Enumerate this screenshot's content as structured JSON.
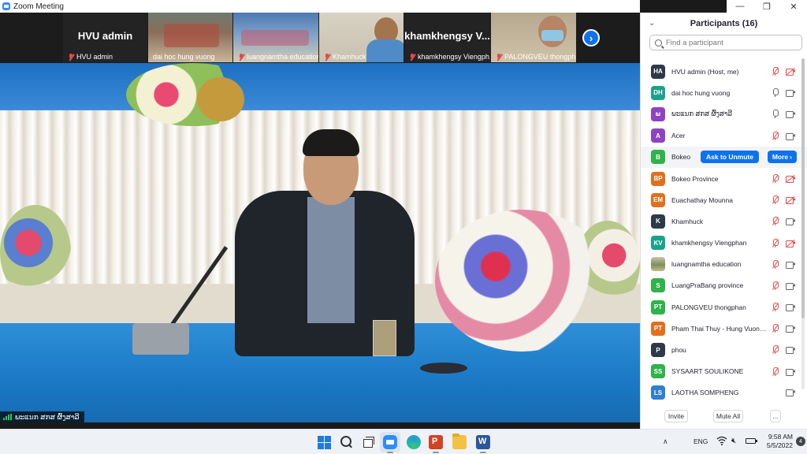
{
  "window": {
    "title": "Zoom Meeting",
    "controls": [
      "—",
      "❐",
      "✕"
    ]
  },
  "thumbnails": [
    {
      "name": "HVU admin",
      "big_label": "HVU admin",
      "muted": true
    },
    {
      "name": "dai hoc hung vuong",
      "muted": false
    },
    {
      "name": "luangnamtha education",
      "muted": true
    },
    {
      "name": "Khamhuck",
      "muted": true
    },
    {
      "name": "khamkhengsy Viengph...",
      "big_label": "khamkhengsy  V...",
      "muted": true
    },
    {
      "name": "PALONGVEU thongph...",
      "muted": true
    }
  ],
  "main_video": {
    "speaker_name": "ພະແນກ ສກສ ຜົ້ງສາລີ"
  },
  "participants_panel": {
    "title": "Participants (16)",
    "search_placeholder": "Find a participant",
    "participants": [
      {
        "initials": "HA",
        "name": "HVU admin (Host, me)",
        "color": "#2e3a4a",
        "mic": "off",
        "video": "off"
      },
      {
        "initials": "DH",
        "name": "dai hoc hung vuong",
        "color": "#1aa38a",
        "mic": "on",
        "video": "on"
      },
      {
        "initials": "ພ",
        "name": "ພະແນກ ສກສ ຜົ້ງສາລີ",
        "color": "#8e44c2",
        "mic": "on",
        "video": "on"
      },
      {
        "initials": "A",
        "name": "Acer",
        "color": "#8e44c2",
        "mic": "off",
        "video": "on"
      },
      {
        "initials": "B",
        "name": "Bokeo",
        "color": "#2fb34a",
        "mic": "off",
        "video": "on",
        "hover": true
      },
      {
        "initials": "BP",
        "name": "Bokeo Province",
        "color": "#e0701e",
        "mic": "off",
        "video": "off"
      },
      {
        "initials": "EM",
        "name": "Euachathay Mounna",
        "color": "#e0701e",
        "mic": "off",
        "video": "off"
      },
      {
        "initials": "K",
        "name": "Khamhuck",
        "color": "#2e3a4a",
        "mic": "off",
        "video": "on"
      },
      {
        "initials": "KV",
        "name": "khamkhengsy Viengphan",
        "color": "#1aa38a",
        "mic": "off",
        "video": "off"
      },
      {
        "initials": "",
        "name": "luangnamtha education",
        "color": "#b4a988",
        "mic": "off",
        "video": "on",
        "photo": true
      },
      {
        "initials": "S",
        "name": "LuangPraBang province",
        "color": "#2fb34a",
        "mic": "off",
        "video": "on"
      },
      {
        "initials": "PT",
        "name": "PALONGVEU thongphan",
        "color": "#2fb34a",
        "mic": "off",
        "video": "on"
      },
      {
        "initials": "PT",
        "name": "Pham Thai Thuy - Hung Vuong U...",
        "color": "#e0701e",
        "mic": "off",
        "video": "on"
      },
      {
        "initials": "P",
        "name": "phou",
        "color": "#2e3a4a",
        "mic": "off",
        "video": "on"
      },
      {
        "initials": "SS",
        "name": "SYSAART SOULIKONE",
        "color": "#2fb34a",
        "mic": "off",
        "video": "on"
      },
      {
        "initials": "LS",
        "name": "LAOTHA SOMPHENG",
        "color": "#2f7fd0",
        "mic": "none",
        "video": "on"
      }
    ],
    "hover_actions": {
      "unmute": "Ask to Unmute",
      "more": "More"
    },
    "footer": {
      "invite": "Invite",
      "mute_all": "Mute All",
      "more": "..."
    }
  },
  "taskbar": {
    "language": "ENG",
    "time": "9:58 AM",
    "date": "5/5/2022",
    "notifications": "4"
  }
}
